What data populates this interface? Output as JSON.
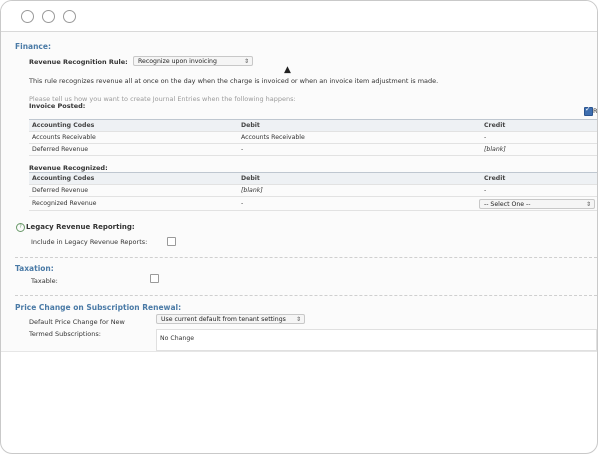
{
  "window": {
    "controls": [
      "close",
      "minimize",
      "zoom"
    ]
  },
  "finance": {
    "title": "Finance:",
    "rule_label": "Revenue Recognition Rule:",
    "rule_value": "Recognize upon invoicing",
    "rule_description": "This rule recognizes revenue all at once on the day when the charge is invoiced or when an invoice item adjustment is made.",
    "journal_hint": "Please tell us how you want to create Journal Entries when the following happens:",
    "invoice_posted": {
      "title": "Invoice Posted:",
      "headers": [
        "Accounting Codes",
        "Debit",
        "Credit"
      ],
      "rows": [
        [
          "Accounts Receivable",
          "Accounts Receivable",
          "-"
        ],
        [
          "Deferred Revenue",
          "-",
          "[blank]"
        ]
      ],
      "checkbox_label": "R"
    },
    "revenue_recognized": {
      "title": "Revenue Recognized:",
      "headers": [
        "Accounting Codes",
        "Debit",
        "Credit"
      ],
      "rows": [
        [
          "Deferred Revenue",
          "[blank]",
          "-"
        ],
        [
          "Recognized Revenue",
          "-",
          ""
        ]
      ],
      "credit_select": "-- Select One --"
    }
  },
  "legacy": {
    "title": "Legacy Revenue Reporting:",
    "include_label": "Include in Legacy Revenue Reports:"
  },
  "taxation": {
    "title": "Taxation:",
    "taxable_label": "Taxable:"
  },
  "price_change": {
    "title": "Price Change on Subscription Renewal:",
    "default_label": "Default Price Change for New",
    "default_value": "Use current default from tenant settings",
    "termed_label": "Termed Subscriptions:",
    "termed_value": "No Change"
  }
}
